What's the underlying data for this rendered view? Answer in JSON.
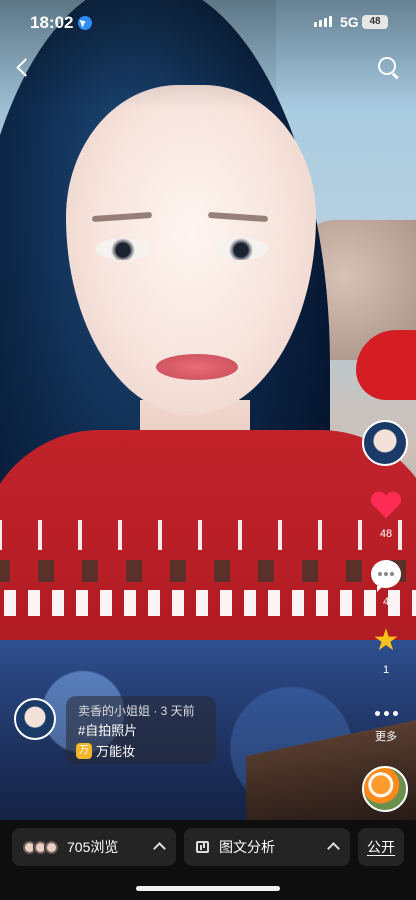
{
  "status_bar": {
    "time": "18:02",
    "network": "5G",
    "battery": "48"
  },
  "post": {
    "author_line": "卖香的小姐姐 · 3 天前",
    "hashtag": "#自拍照片",
    "app_icon": "万",
    "app_label": "万能妆"
  },
  "rail": {
    "likes": "48",
    "comments": "4",
    "favorites": "1",
    "more": "更多"
  },
  "bottom": {
    "views_label": "705浏览",
    "analysis_label": "图文分析",
    "public_label": "公开"
  },
  "colors": {
    "like": "#fe2c55",
    "star": "#f7c21a",
    "location": "#2e8cf5"
  }
}
